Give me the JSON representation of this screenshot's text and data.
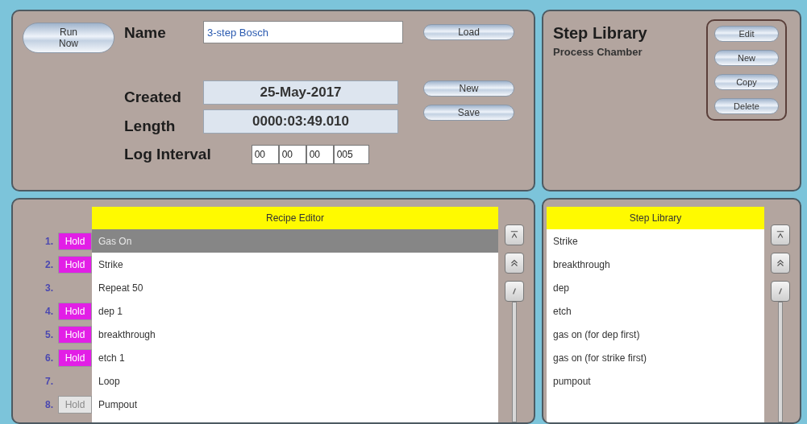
{
  "recipe": {
    "run_button": "Run\nNow",
    "name_label": "Name",
    "name_value": "3-step Bosch",
    "load_button": "Load",
    "created_label": "Created",
    "created_value": "25-May-2017",
    "new_button": "New",
    "length_label": "Length",
    "length_value": "0000:03:49.010",
    "save_button": "Save",
    "log_label": "Log Interval",
    "log_fields": [
      "00",
      "00",
      "00",
      "005"
    ]
  },
  "library": {
    "title": "Step Library",
    "subtitle": "Process Chamber",
    "buttons": [
      "Edit",
      "New",
      "Copy",
      "Delete"
    ]
  },
  "recipe_editor": {
    "header": "Recipe Editor",
    "rows": [
      {
        "number": "1.",
        "hold": {
          "label": "Hold",
          "active": true
        },
        "step": "Gas On",
        "selected": true
      },
      {
        "number": "2.",
        "hold": {
          "label": "Hold",
          "active": true
        },
        "step": "Strike",
        "selected": false
      },
      {
        "number": "3.",
        "step": "Repeat  50",
        "selected": false
      },
      {
        "number": "4.",
        "hold": {
          "label": "Hold",
          "active": true
        },
        "step": "dep 1",
        "selected": false
      },
      {
        "number": "5.",
        "hold": {
          "label": "Hold",
          "active": true
        },
        "step": "breakthrough",
        "selected": false
      },
      {
        "number": "6.",
        "hold": {
          "label": "Hold",
          "active": true
        },
        "step": "etch 1",
        "selected": false
      },
      {
        "number": "7.",
        "step": "Loop",
        "selected": false
      },
      {
        "number": "8.",
        "hold": {
          "label": "Hold",
          "active": false
        },
        "step": "Pumpout",
        "selected": false
      }
    ]
  },
  "step_library": {
    "header": "Step Library",
    "items": [
      "Strike",
      "breakthrough",
      "dep",
      "etch",
      "gas on (for dep first)",
      "gas on (for strike first)",
      "pumpout"
    ]
  }
}
